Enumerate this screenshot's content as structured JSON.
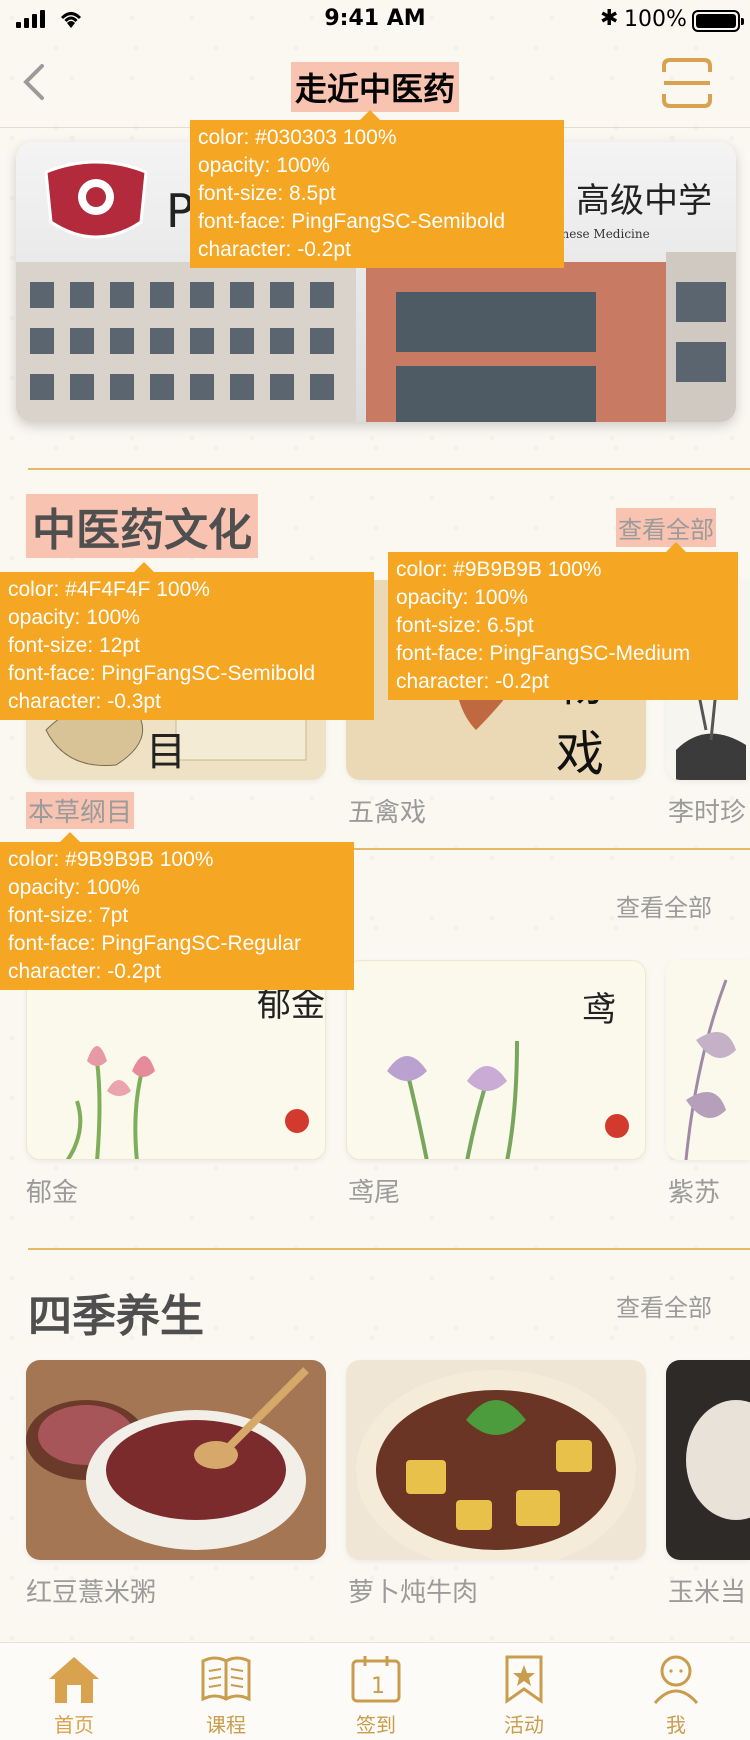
{
  "status_bar": {
    "time": "9:41 AM",
    "battery_pct": "100%",
    "bluetooth": "✱"
  },
  "nav": {
    "title": "走近中医药",
    "back_icon": "chevron-left-icon",
    "scan_icon": "scan-icon"
  },
  "banner": {
    "school_name": "高级中学",
    "school_sub": "onal Chinese Medicine",
    "prefix": "Pu"
  },
  "sections": [
    {
      "title": "中医药文化",
      "view_all": "查看全部",
      "items": [
        {
          "label": "本草纲目"
        },
        {
          "label": "五禽戏"
        },
        {
          "label": "李时珍"
        }
      ]
    },
    {
      "title": "",
      "view_all": "查看全部",
      "items": [
        {
          "label": "郁金"
        },
        {
          "label": "鸢尾"
        },
        {
          "label": "紫苏"
        }
      ]
    },
    {
      "title": "四季养生",
      "view_all": "查看全部",
      "items": [
        {
          "label": "红豆薏米粥"
        },
        {
          "label": "萝卜炖牛肉"
        },
        {
          "label": "玉米当"
        }
      ]
    }
  ],
  "annotations": {
    "nav_title": [
      "color: #030303 100%",
      "opacity: 100%",
      "font-size: 8.5pt",
      "font-face: PingFangSC-Semibold",
      "character: -0.2pt"
    ],
    "section_title": [
      "color: #4F4F4F 100%",
      "opacity: 100%",
      "font-size: 12pt",
      "font-face: PingFangSC-Semibold",
      "character: -0.3pt"
    ],
    "view_all": [
      "color: #9B9B9B 100%",
      "opacity: 100%",
      "font-size: 6.5pt",
      "font-face: PingFangSC-Medium",
      "character: -0.2pt"
    ],
    "card_label": [
      "color: #9B9B9B 100%",
      "opacity: 100%",
      "font-size: 7pt",
      "font-face: PingFangSC-Regular",
      "character: -0.2pt"
    ]
  },
  "tabbar": [
    {
      "label": "首页",
      "icon": "home-icon",
      "active": true
    },
    {
      "label": "课程",
      "icon": "book-icon",
      "active": false
    },
    {
      "label": "签到",
      "icon": "calendar-icon",
      "active": false
    },
    {
      "label": "活动",
      "icon": "bookmark-star-icon",
      "active": false
    },
    {
      "label": "我",
      "icon": "person-icon",
      "active": false
    }
  ],
  "colors": {
    "accent": "#D9A24E",
    "tip_bg": "#F5A623",
    "highlight": "#F8C3B0",
    "title": "#4F4F4F",
    "muted": "#9B9B9B"
  },
  "calendar_day": "1"
}
